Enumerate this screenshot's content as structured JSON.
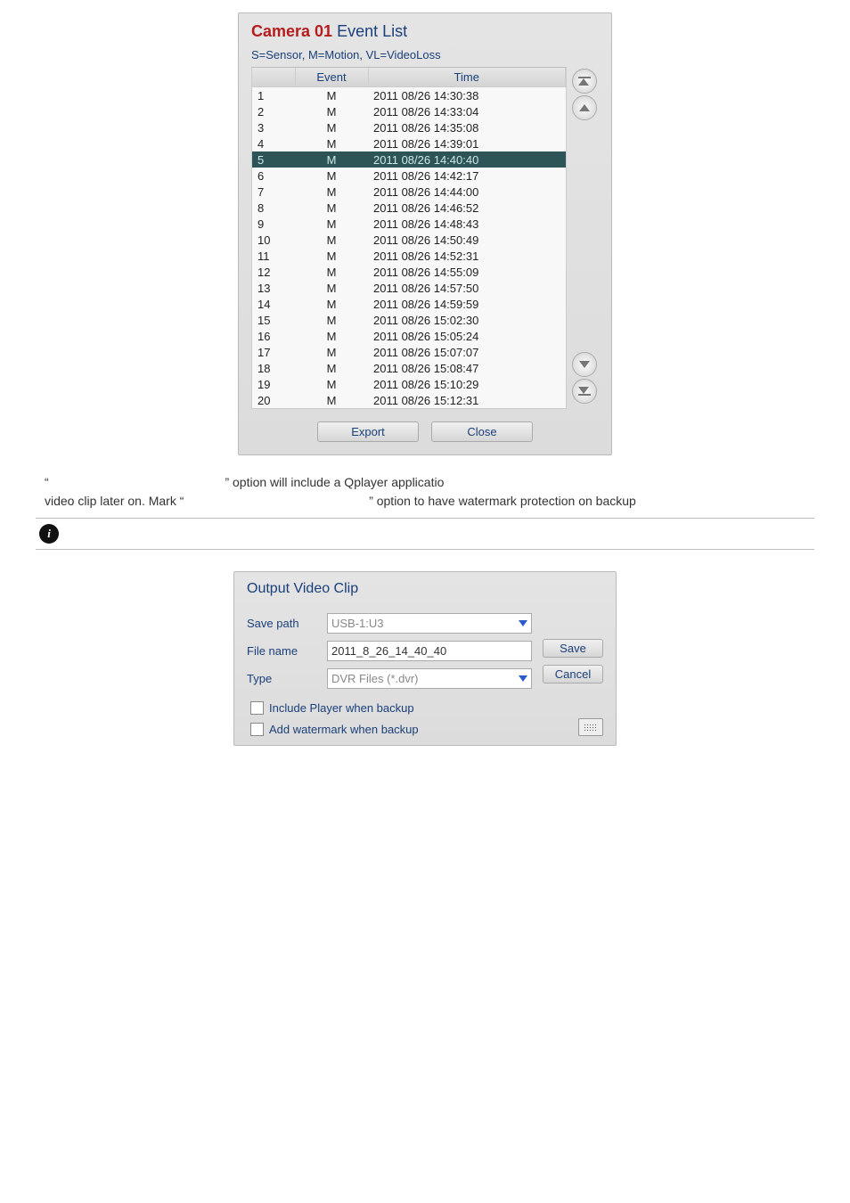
{
  "event_list": {
    "title_red": "Camera 01",
    "title_blue": " Event List",
    "legend": "S=Sensor, M=Motion, VL=VideoLoss",
    "headers": {
      "event": "Event",
      "time": "Time"
    },
    "selected_index": 5,
    "rows": [
      {
        "idx": "1",
        "event": "M",
        "time": "2011 08/26 14:30:38"
      },
      {
        "idx": "2",
        "event": "M",
        "time": "2011 08/26 14:33:04"
      },
      {
        "idx": "3",
        "event": "M",
        "time": "2011 08/26 14:35:08"
      },
      {
        "idx": "4",
        "event": "M",
        "time": "2011 08/26 14:39:01"
      },
      {
        "idx": "5",
        "event": "M",
        "time": "2011 08/26 14:40:40"
      },
      {
        "idx": "6",
        "event": "M",
        "time": "2011 08/26 14:42:17"
      },
      {
        "idx": "7",
        "event": "M",
        "time": "2011 08/26 14:44:00"
      },
      {
        "idx": "8",
        "event": "M",
        "time": "2011 08/26 14:46:52"
      },
      {
        "idx": "9",
        "event": "M",
        "time": "2011 08/26 14:48:43"
      },
      {
        "idx": "10",
        "event": "M",
        "time": "2011 08/26 14:50:49"
      },
      {
        "idx": "11",
        "event": "M",
        "time": "2011 08/26 14:52:31"
      },
      {
        "idx": "12",
        "event": "M",
        "time": "2011 08/26 14:55:09"
      },
      {
        "idx": "13",
        "event": "M",
        "time": "2011 08/26 14:57:50"
      },
      {
        "idx": "14",
        "event": "M",
        "time": "2011 08/26 14:59:59"
      },
      {
        "idx": "15",
        "event": "M",
        "time": "2011 08/26 15:02:30"
      },
      {
        "idx": "16",
        "event": "M",
        "time": "2011 08/26 15:05:24"
      },
      {
        "idx": "17",
        "event": "M",
        "time": "2011 08/26 15:07:07"
      },
      {
        "idx": "18",
        "event": "M",
        "time": "2011 08/26 15:08:47"
      },
      {
        "idx": "19",
        "event": "M",
        "time": "2011 08/26 15:10:29"
      },
      {
        "idx": "20",
        "event": "M",
        "time": "2011 08/26 15:12:31"
      }
    ],
    "export_label": "Export",
    "close_label": "Close"
  },
  "body_text": {
    "p1_q1": "“",
    "p1_mid": "” option will include a Qplayer applicatio",
    "p2_pre": "video clip later on. Mark “",
    "p2_post": "” option to have watermark protection on backup"
  },
  "output_clip": {
    "title": "Output Video Clip",
    "save_path_label": "Save path",
    "save_path_value": "USB-1:U3",
    "file_name_label": "File name",
    "file_name_value": "2011_8_26_14_40_40",
    "type_label": "Type",
    "type_value": "DVR Files (*.dvr)",
    "save_button": "Save",
    "cancel_button": "Cancel",
    "check1": "Include Player when backup",
    "check2": "Add watermark when backup"
  }
}
